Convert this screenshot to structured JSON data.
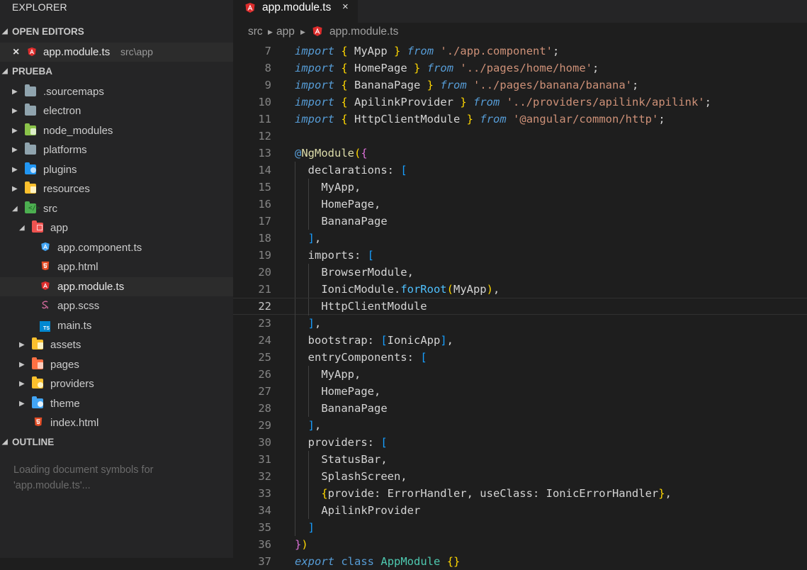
{
  "sidebar": {
    "title": "EXPLORER",
    "open_editors": {
      "label": "OPEN EDITORS",
      "file": {
        "name": "app.module.ts",
        "path": "src\\app",
        "close_icon": "×"
      }
    },
    "project": {
      "label": "PRUEBA",
      "items": [
        {
          "name": ".sourcemaps",
          "icon": "folder-icon",
          "color": "#90a4ae"
        },
        {
          "name": "electron",
          "icon": "folder-icon",
          "color": "#90a4ae"
        },
        {
          "name": "node_modules",
          "icon": "node-folder-icon",
          "color": "#8bc34a"
        },
        {
          "name": "platforms",
          "icon": "folder-icon",
          "color": "#90a4ae"
        },
        {
          "name": "plugins",
          "icon": "plugin-folder-icon",
          "color": "#2196f3"
        },
        {
          "name": "resources",
          "icon": "resource-folder-icon",
          "color": "#fbc02d"
        },
        {
          "name": "src",
          "icon": "src-folder-icon",
          "color": "#4caf50"
        },
        {
          "name": "app",
          "icon": "app-folder-icon",
          "color": "#ef5350"
        },
        {
          "name": "app.component.ts",
          "icon": "angular-component-icon",
          "color": "#42a5f5"
        },
        {
          "name": "app.html",
          "icon": "html5-icon",
          "color": "#e44d26"
        },
        {
          "name": "app.module.ts",
          "icon": "angular-icon",
          "color": "#dd2c2c"
        },
        {
          "name": "app.scss",
          "icon": "sass-icon",
          "color": "#cd6799"
        },
        {
          "name": "main.ts",
          "icon": "typescript-icon",
          "color": "#0288d1"
        },
        {
          "name": "assets",
          "icon": "assets-folder-icon",
          "color": "#fbc02d"
        },
        {
          "name": "pages",
          "icon": "pages-folder-icon",
          "color": "#ff7043"
        },
        {
          "name": "providers",
          "icon": "providers-folder-icon",
          "color": "#fbc02d"
        },
        {
          "name": "theme",
          "icon": "theme-folder-icon",
          "color": "#42a5f5"
        },
        {
          "name": "index.html",
          "icon": "html5-icon",
          "color": "#e44d26"
        }
      ]
    },
    "outline": {
      "label": "OUTLINE",
      "message": "Loading document symbols for 'app.module.ts'..."
    }
  },
  "editor": {
    "tab": {
      "label": "app.module.ts",
      "close": "×"
    },
    "breadcrumb": [
      "src",
      "app",
      "app.module.ts"
    ],
    "current_line": 22,
    "line_numbers": [
      "7",
      "8",
      "9",
      "10",
      "11",
      "12",
      "13",
      "14",
      "15",
      "16",
      "17",
      "18",
      "19",
      "20",
      "21",
      "22",
      "23",
      "24",
      "25",
      "26",
      "27",
      "28",
      "29",
      "30",
      "31",
      "32",
      "33",
      "34",
      "35",
      "36",
      "37"
    ]
  },
  "colors": {
    "keyword": "#569cd6",
    "string": "#ce9178",
    "text": "#d4d4d4",
    "sidebar_bg": "#252526",
    "editor_bg": "#1e1e1e"
  }
}
